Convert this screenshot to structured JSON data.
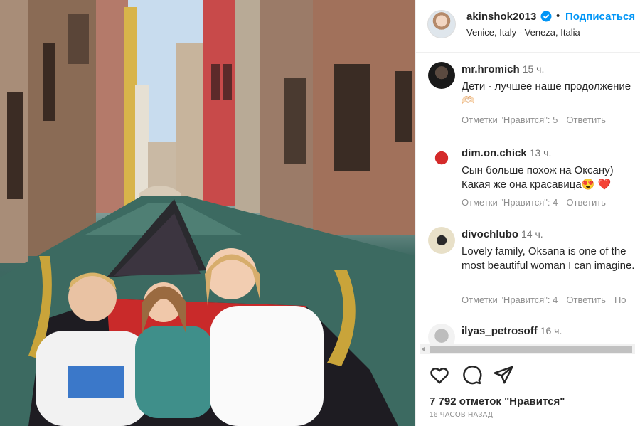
{
  "post": {
    "image_description_icon": "photo-icon"
  },
  "header": {
    "username": "akinshok2013",
    "follow_separator": "•",
    "follow_label": "Подписаться",
    "location": "Venice, Italy - Veneza, Italia"
  },
  "comments": [
    {
      "user": "mr.hromich",
      "time": "15 ч.",
      "text": "Дети - лучшее наше продолжение 🫶🏻",
      "likes": "Отметки \"Нравится\": 5",
      "reply": "Ответить"
    },
    {
      "user": "dim.on.chick",
      "time": "13 ч.",
      "text": "Сын больше похож на Оксану) Какая же она красавица😍 ❤️",
      "likes": "Отметки \"Нравится\": 4",
      "reply": "Ответить"
    },
    {
      "user": "divochlubo",
      "time": "14 ч.",
      "text": "Lovely family, Oksana is one of the most beautiful woman I can imagine.",
      "likes": "Отметки \"Нравится\": 4",
      "reply": "Ответить",
      "extra": "По"
    },
    {
      "user": "ilyas_petrosoff",
      "time": "16 ч.",
      "text": ""
    }
  ],
  "footer": {
    "likes_count": "7 792 отметок \"Нравится\"",
    "time_ago": "16 ЧАСОВ НАЗАД"
  },
  "icons": {
    "like": "heart-icon",
    "comment": "comment-icon",
    "share": "share-icon",
    "verified": "verified-badge-icon"
  },
  "colors": {
    "accent": "#0095f6",
    "text": "#262626",
    "secondary": "#8e8e8e"
  }
}
